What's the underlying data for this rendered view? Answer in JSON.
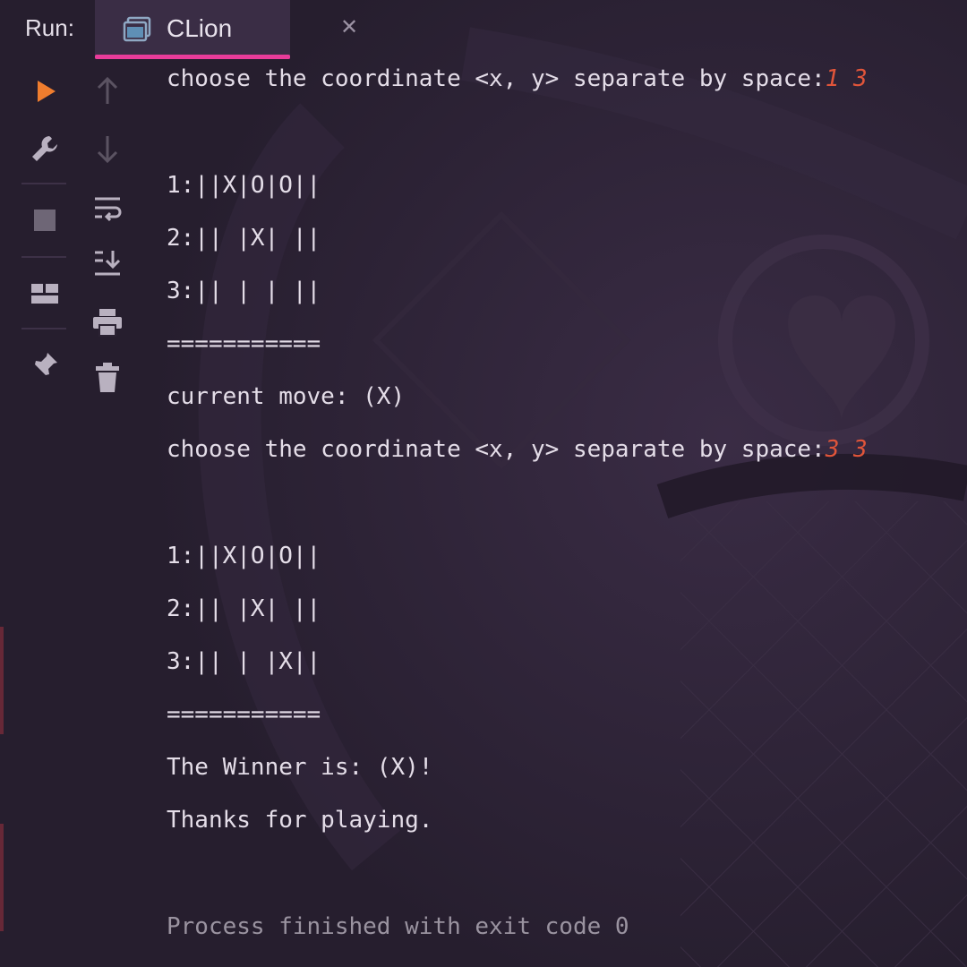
{
  "header": {
    "run_label": "Run:",
    "tab": {
      "label": "CLion",
      "close_glyph": "✕"
    }
  },
  "toolbar_left": {
    "items": [
      {
        "name": "run-icon",
        "color": "#ef7d2e"
      },
      {
        "name": "wrench-icon"
      },
      {
        "name": "stop-icon"
      },
      {
        "name": "layout-icon"
      },
      {
        "name": "pin-icon"
      }
    ]
  },
  "toolbar_right": {
    "items": [
      {
        "name": "arrow-up-icon"
      },
      {
        "name": "arrow-down-icon"
      },
      {
        "name": "soft-wrap-icon"
      },
      {
        "name": "scroll-to-end-icon"
      },
      {
        "name": "print-icon"
      },
      {
        "name": "trash-icon"
      }
    ]
  },
  "console": {
    "lines": [
      {
        "text": "choose the coordinate <x, y> separate by space:",
        "input": "1 3"
      },
      {
        "text": ""
      },
      {
        "text": "1:||X|O|O||"
      },
      {
        "text": "2:|| |X| ||"
      },
      {
        "text": "3:|| | | ||"
      },
      {
        "text": "==========="
      },
      {
        "text": "current move: (X)"
      },
      {
        "text": "choose the coordinate <x, y> separate by space:",
        "input": "3 3"
      },
      {
        "text": ""
      },
      {
        "text": "1:||X|O|O||"
      },
      {
        "text": "2:|| |X| ||"
      },
      {
        "text": "3:|| | |X||"
      },
      {
        "text": "==========="
      },
      {
        "text": "The Winner is: (X)!"
      },
      {
        "text": "Thanks for playing."
      },
      {
        "text": ""
      },
      {
        "text": "Process finished with exit code 0",
        "kind": "process"
      }
    ]
  },
  "colors": {
    "background": "#2b2233",
    "accent": "#e83c9a",
    "input": "#e0553a",
    "text": "#e4dde8",
    "muted": "#9a93a0"
  }
}
